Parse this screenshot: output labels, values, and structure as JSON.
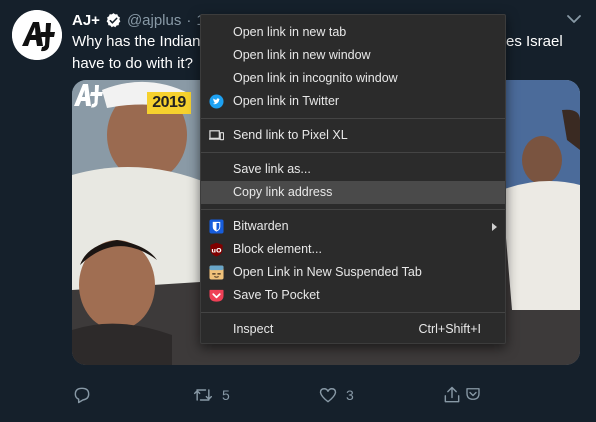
{
  "tweet": {
    "author": "AJ+",
    "handle": "@ajplus",
    "time_fragment": "1",
    "text_line1": "Why has the Indian",
    "text_line1_tail": "es Israel",
    "text_line2": "have to do with it?",
    "media": {
      "year_badge": "2019"
    },
    "actions": {
      "retweets": "5",
      "likes": "3"
    }
  },
  "context_menu": {
    "items": [
      {
        "label": "Open link in new tab"
      },
      {
        "label": "Open link in new window"
      },
      {
        "label": "Open link in incognito window"
      },
      {
        "label": "Open link in Twitter",
        "icon": "twitter-icon"
      },
      {
        "label": "Send link to Pixel XL",
        "icon": "device-icon"
      },
      {
        "label": "Save link as..."
      },
      {
        "label": "Copy link address",
        "state": "highlighted"
      },
      {
        "label": "Bitwarden",
        "icon": "bitwarden-icon",
        "submenu": true
      },
      {
        "label": "Block element...",
        "icon": "ublock-icon"
      },
      {
        "label": "Open Link in New Suspended Tab",
        "icon": "suspender-icon"
      },
      {
        "label": "Save To Pocket",
        "icon": "pocket-icon"
      },
      {
        "label": "Inspect",
        "shortcut": "Ctrl+Shift+I"
      }
    ]
  },
  "colors": {
    "background": "#15202b",
    "secondary_text": "#8899a6",
    "twitter_blue": "#1da1f2",
    "menu_background": "#2b2b2b",
    "menu_highlight": "#4a4a4a",
    "pocket_red": "#ef4056",
    "bitwarden_blue": "#175ddc",
    "ublock_red": "#800000"
  }
}
